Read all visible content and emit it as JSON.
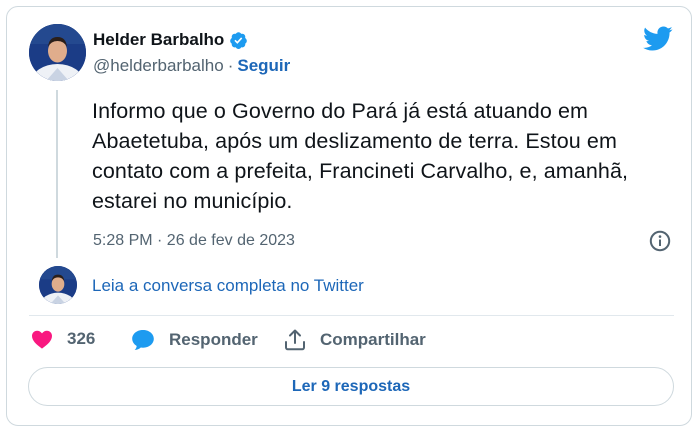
{
  "author": {
    "display_name": "Helder Barbalho",
    "handle": "@helderbarbalho",
    "separator": "·",
    "follow_label": "Seguir",
    "verified": true
  },
  "tweet": {
    "text": "Informo que o Governo do Pará já está atuando em Abaetetuba, após um deslizamento de terra. Estou em contato com a prefeita, Francineti Carvalho, e, amanhã, estarei no município.",
    "timestamp": "5:28 PM · 26 de fev de 2023"
  },
  "conversation_link": "Leia a conversa completa no Twitter",
  "actions": {
    "like_count": "326",
    "reply_label": "Responder",
    "share_label": "Compartilhar"
  },
  "read_replies_label": "Ler 9 respostas",
  "icons": {
    "brand": "twitter-bird-icon",
    "verified": "verified-badge-icon",
    "info": "info-icon",
    "like": "heart-icon",
    "reply": "speech-bubble-icon",
    "share": "share-upload-icon"
  },
  "colors": {
    "brand_blue": "#1d9bf0",
    "link_blue": "#1d67b8",
    "like_pink": "#f91880",
    "muted_text": "#536471",
    "border": "#cfd9de"
  }
}
